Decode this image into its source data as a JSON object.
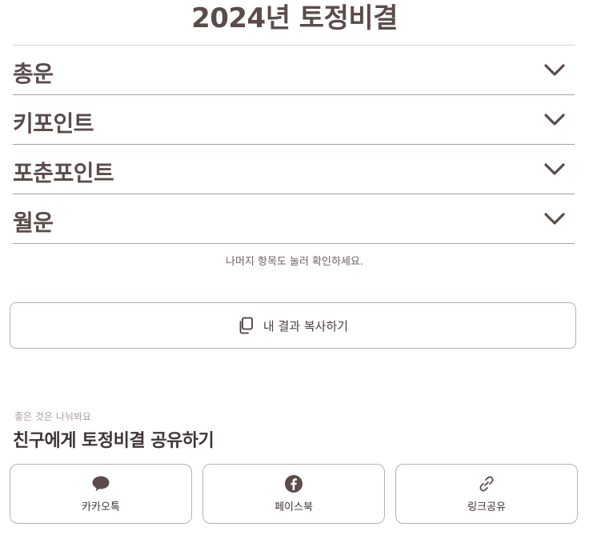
{
  "page": {
    "title": "2024년 토정비결"
  },
  "accordion": {
    "items": [
      {
        "label": "총운",
        "icon": "chevron-down-icon"
      },
      {
        "label": "키포인트",
        "icon": "chevron-down-icon"
      },
      {
        "label": "포춘포인트",
        "icon": "chevron-down-icon"
      },
      {
        "label": "월운",
        "icon": "chevron-down-icon"
      }
    ]
  },
  "hint": "나머지 항목도 눌러 확인하세요.",
  "copy": {
    "label": "내 결과 복사하기",
    "icon": "copy-icon"
  },
  "share": {
    "subtitle": "좋은 것은 나눠봐요",
    "title": "친구에게 토정비결 공유하기",
    "buttons": [
      {
        "label": "카카오톡",
        "icon": "speech-bubble-icon"
      },
      {
        "label": "페이스북",
        "icon": "facebook-icon"
      },
      {
        "label": "링크공유",
        "icon": "link-icon"
      }
    ]
  },
  "colors": {
    "text": "#5b4c4c",
    "border": "#b9b1b1",
    "divider": "#a79e9e",
    "muted": "#a89e9e"
  }
}
